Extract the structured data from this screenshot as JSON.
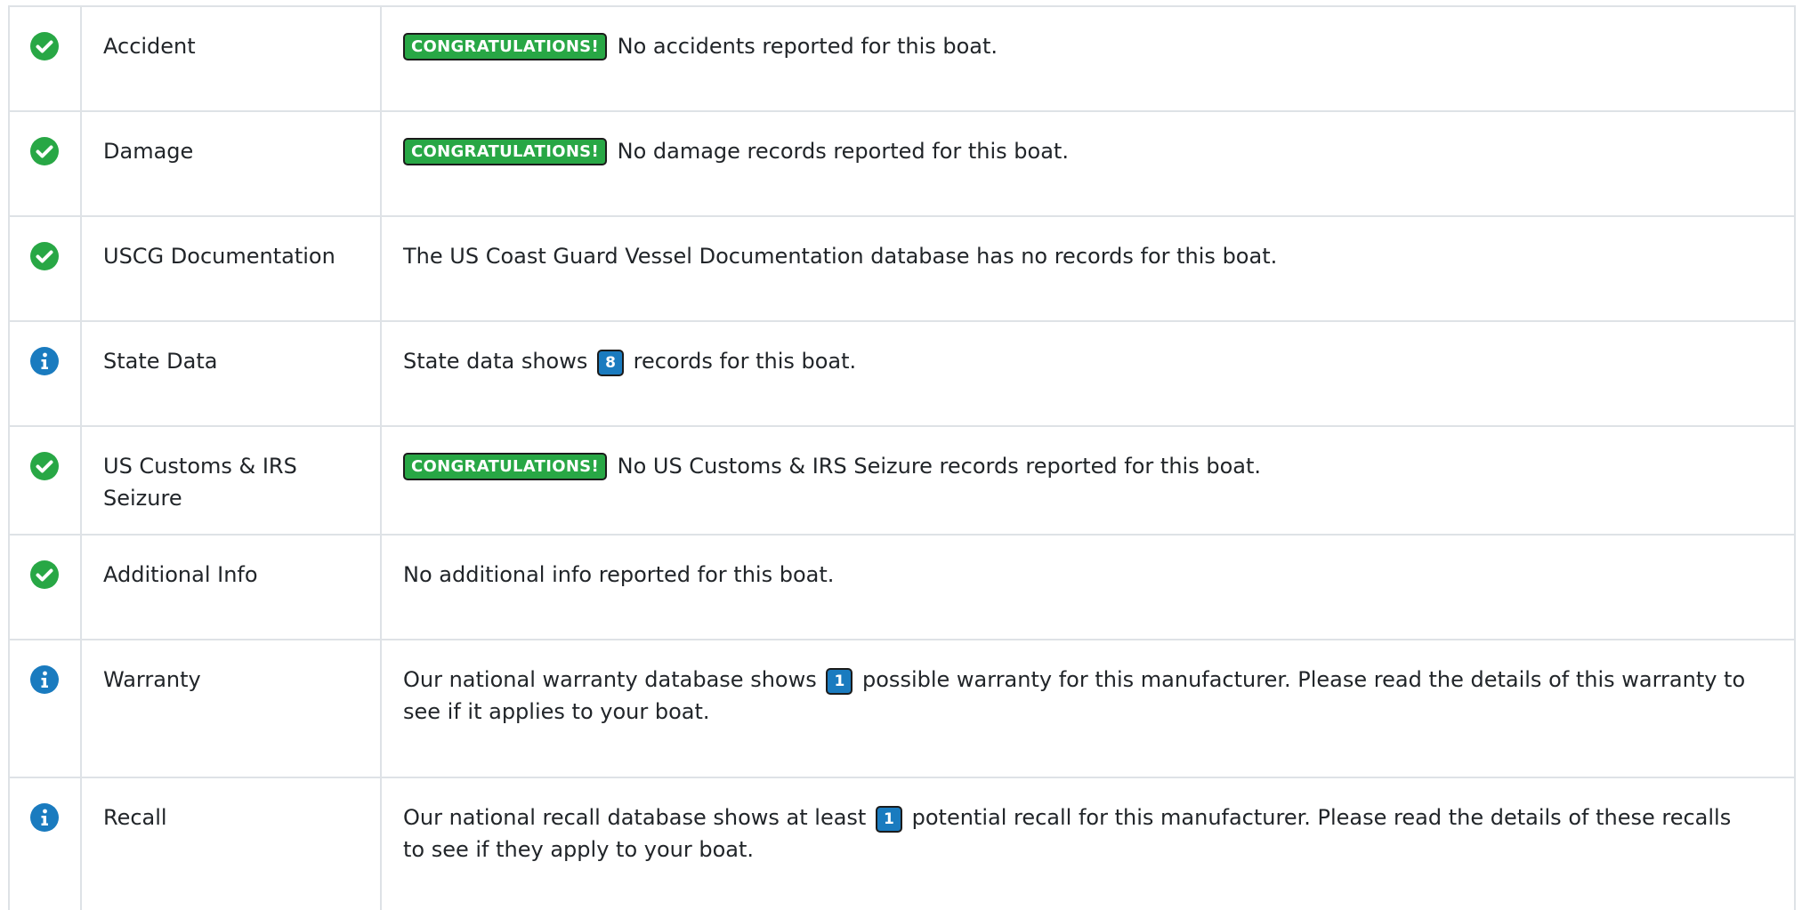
{
  "colors": {
    "ok_green": "#28a745",
    "info_blue": "#1a7bbf",
    "border": "#dee2e6"
  },
  "rows": [
    {
      "icon": "check-circle-icon",
      "label": "Accident",
      "badge": "CONGRATULATIONS!",
      "text": "No accidents reported for this boat."
    },
    {
      "icon": "check-circle-icon",
      "label": "Damage",
      "badge": "CONGRATULATIONS!",
      "text": "No damage records reported for this boat."
    },
    {
      "icon": "check-circle-icon",
      "label": "USCG Documentation",
      "text": "The US Coast Guard Vessel Documentation database has no records for this boat."
    },
    {
      "icon": "info-circle-icon",
      "label": "State Data",
      "text_before": "State data shows",
      "count": "8",
      "text_after": "records for this boat."
    },
    {
      "icon": "check-circle-icon",
      "label": "US Customs & IRS Seizure",
      "badge": "CONGRATULATIONS!",
      "text": "No US Customs & IRS Seizure records reported for this boat."
    },
    {
      "icon": "check-circle-icon",
      "label": "Additional Info",
      "text": "No additional info reported for this boat."
    },
    {
      "icon": "info-circle-icon",
      "label": "Warranty",
      "text_before": "Our national warranty database shows",
      "count": "1",
      "text_after": "possible warranty for this manufacturer. Please read the details of this warranty to see if it applies to your boat."
    },
    {
      "icon": "info-circle-icon",
      "label": "Recall",
      "text_before": "Our national recall database shows at least",
      "count": "1",
      "text_after": "potential recall for this manufacturer. Please read the details of these recalls to see if they apply to your boat."
    }
  ]
}
